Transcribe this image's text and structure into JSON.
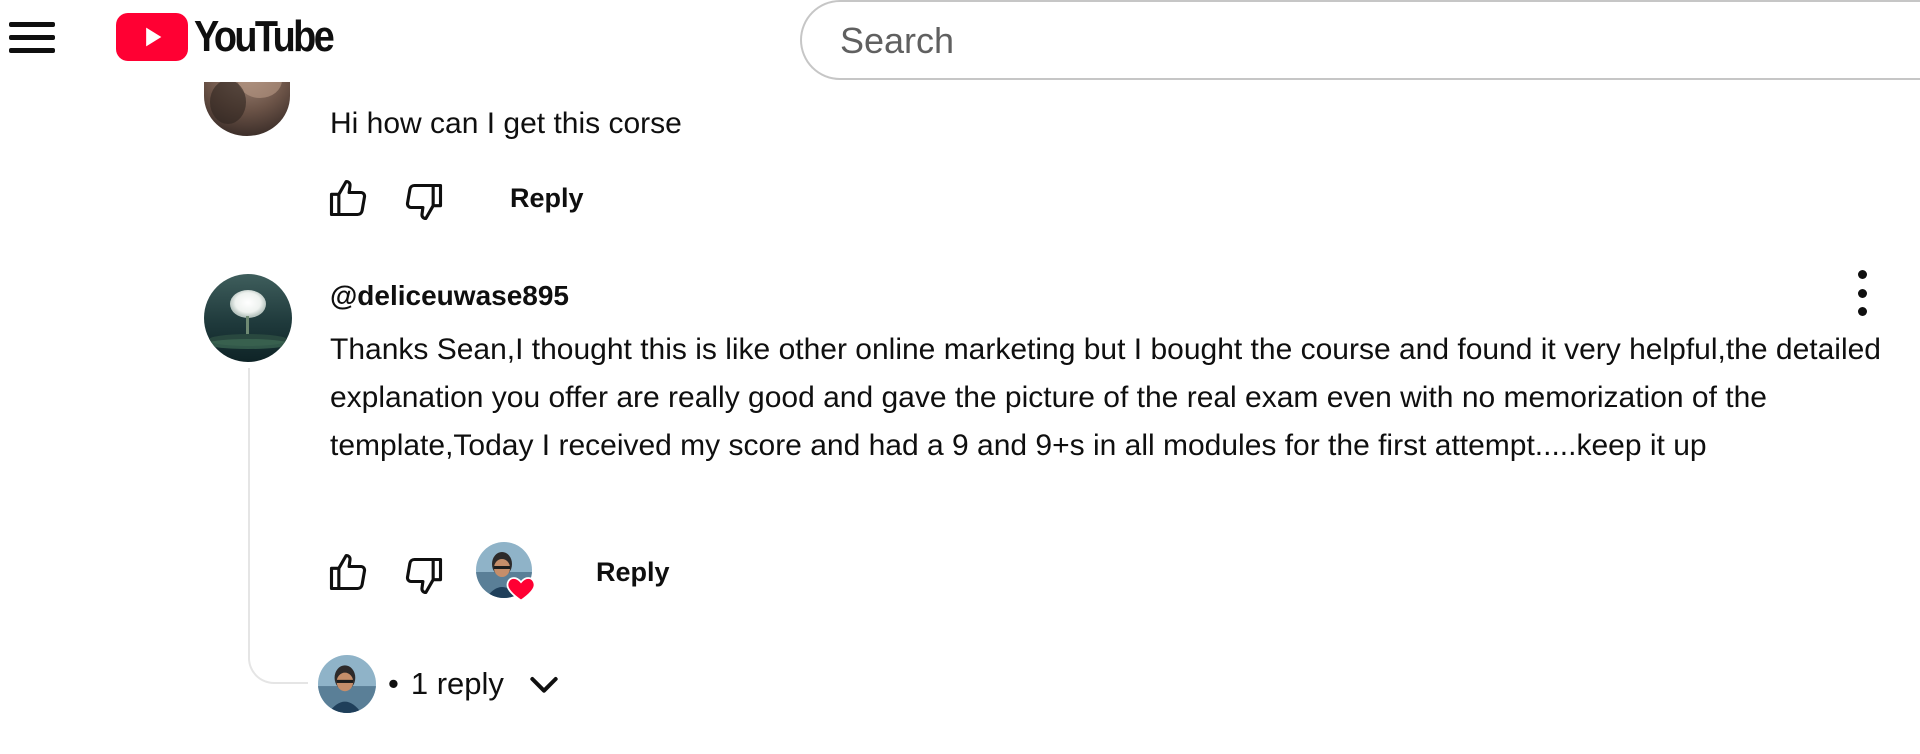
{
  "app": {
    "logo_text": "YouTube",
    "brand_color": "#ff0033"
  },
  "header": {
    "menu_icon": "hamburger-menu-icon",
    "search": {
      "placeholder": "Search",
      "value": ""
    }
  },
  "comments": [
    {
      "author": "",
      "text": "Hi how can I get this corse",
      "reply_label": "Reply"
    },
    {
      "author": "@deliceuwase895",
      "text": "Thanks Sean,I thought this is like other online marketing but I bought the course and found it very helpful,the detailed explanation you offer are really good and gave the picture of the real exam even with no memorization of the template,Today I received my score and had a 9 and 9+s in all modules for the first attempt.....keep it up",
      "reply_label": "Reply",
      "creator_heart": true,
      "replies_label": "1 reply",
      "replies_separator": "•"
    }
  ],
  "icons": {
    "like": "thumbs-up-icon",
    "dislike": "thumbs-down-icon",
    "more": "more-vert-icon",
    "expand": "chevron-down-icon",
    "heart": "heart-icon"
  },
  "colors": {
    "heart": "#ff0033",
    "thread_line": "#e5e5e5",
    "text": "#0f0f0f"
  }
}
